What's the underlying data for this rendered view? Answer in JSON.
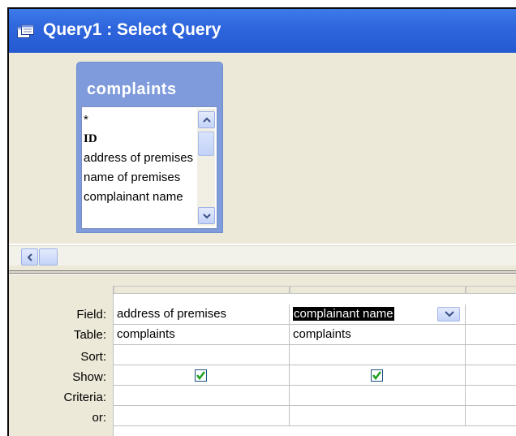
{
  "window": {
    "title": "Query1 : Select Query"
  },
  "field_list": {
    "title": "complaints",
    "items": [
      "*",
      "ID",
      "address of premises",
      "name of premises",
      "complainant name"
    ]
  },
  "grid": {
    "row_labels": {
      "field": "Field:",
      "table": "Table:",
      "sort": "Sort:",
      "show": "Show:",
      "criteria": "Criteria:",
      "or": "or:"
    },
    "columns": [
      {
        "field": "address of premises",
        "table": "complaints",
        "sort": "",
        "show": true,
        "criteria": "",
        "or": ""
      },
      {
        "field": "complainant name",
        "table": "complaints",
        "sort": "",
        "show": true,
        "criteria": "",
        "or": "",
        "selected": true
      }
    ]
  },
  "icons": [
    "query-window-icon",
    "scroll-up-icon",
    "scroll-down-icon",
    "scroll-left-icon",
    "dropdown-arrow-icon",
    "checkmark-icon"
  ],
  "colors": {
    "titlebar": "#2f66dd",
    "field_list_header": "#7f9bdc",
    "checkmark": "#21a121"
  }
}
